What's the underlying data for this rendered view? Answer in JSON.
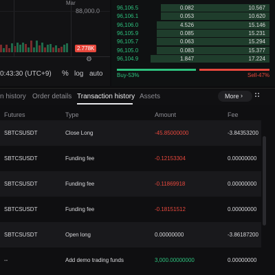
{
  "chart": {
    "month_label": "Mar",
    "price_axis_label": "88,000.0",
    "current_price": "2.778K",
    "time": "0:43:30 (UTC+9)",
    "percent_toggle": "%",
    "log_toggle": "log",
    "auto_toggle": "auto"
  },
  "orderbook": {
    "rows": [
      {
        "price": "96,106.5",
        "qty": "0.082",
        "total": "10.567",
        "depth": 0.71
      },
      {
        "price": "96,106.1",
        "qty": "0.053",
        "total": "10.620",
        "depth": 0.71
      },
      {
        "price": "96,106.0",
        "qty": "4.526",
        "total": "15.146",
        "depth": 0.74
      },
      {
        "price": "96,105.9",
        "qty": "0.085",
        "total": "15.231",
        "depth": 0.74
      },
      {
        "price": "96,105.7",
        "qty": "0.063",
        "total": "15.294",
        "depth": 0.74
      },
      {
        "price": "96,105.0",
        "qty": "0.083",
        "total": "15.377",
        "depth": 0.74
      },
      {
        "price": "96,104.9",
        "qty": "1.847",
        "total": "17.224",
        "depth": 0.78
      }
    ],
    "buy_label": "Buy-53%",
    "sell_label": "Sell-47%",
    "buy_ratio": 0.53
  },
  "tabs": {
    "items": [
      "n history",
      "Order details",
      "Transaction history",
      "Assets"
    ],
    "active_index": 2,
    "more_label": "More"
  },
  "table": {
    "headers": {
      "futures": "Futures",
      "type": "Type",
      "amount": "Amount",
      "fee": "Fee"
    },
    "rows": [
      {
        "futures": "SBTCSUSDT",
        "type": "Close Long",
        "amount": "-45.85000000",
        "fee": "-3.84353200",
        "sign": "neg"
      },
      {
        "futures": "SBTCSUSDT",
        "type": "Funding fee",
        "amount": "-0.12153304",
        "fee": "0.00000000",
        "sign": "neg"
      },
      {
        "futures": "SBTCSUSDT",
        "type": "Funding fee",
        "amount": "-0.11869918",
        "fee": "0.00000000",
        "sign": "neg"
      },
      {
        "futures": "SBTCSUSDT",
        "type": "Funding fee",
        "amount": "-0.18151512",
        "fee": "0.00000000",
        "sign": "neg"
      },
      {
        "futures": "SBTCSUSDT",
        "type": "Open long",
        "amount": "0.00000000",
        "fee": "-3.86187200",
        "sign": "zero"
      },
      {
        "futures": "--",
        "type": "Add demo trading funds",
        "amount": "3,000.00000000",
        "fee": "0.00000000",
        "sign": "pos"
      }
    ]
  },
  "colors": {
    "buy": "#2ec27e",
    "sell": "#e8483d",
    "background": "#0d0d0f"
  }
}
